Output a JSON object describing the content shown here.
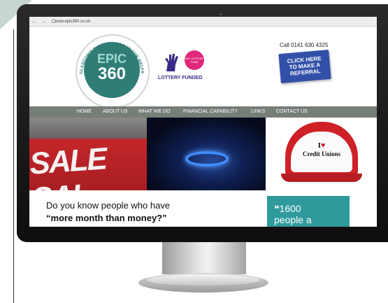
{
  "browser": {
    "url": "www.epic360.co.uk",
    "nav_buttons": "← → C"
  },
  "logo": {
    "epic": "EPIC",
    "number": "360",
    "arc_text": "GLASGOW'S BIG PARTNERSHIP FOR WELFARE"
  },
  "funder": {
    "label": "LOTTERY FUNDED",
    "badge_text": "BIG LOTTERY FUND"
  },
  "header": {
    "phone": "Call 0141 630 4325",
    "referral_line1": "CLICK HERE",
    "referral_line2": "TO MAKE A",
    "referral_line3": "REFERRAL"
  },
  "nav": {
    "items": [
      "HOME",
      "ABOUT US",
      "WHAT WE DO",
      "FINANCIAL CAPABILITY",
      "LINKS",
      "CONTACT US"
    ]
  },
  "banner": {
    "sale_text": "SALE SAL",
    "cap_line1": "I",
    "cap_line2": "Credit Unions"
  },
  "main": {
    "headline_line1": "Do you know people who have",
    "headline_line2": "“more month than money?”",
    "stat_text": "❝1600",
    "stat_text2": "people a"
  },
  "colors": {
    "nav_bg": "#757f78",
    "logo_teal": "#2f7d74",
    "referral_blue": "#3250a8",
    "stat_teal": "#2e9a9c",
    "lottery_pink": "#e0287a"
  }
}
